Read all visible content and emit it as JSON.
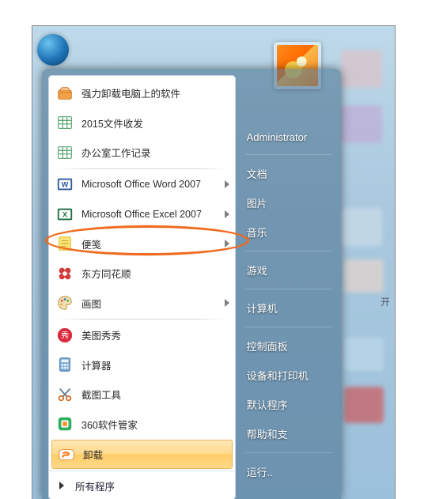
{
  "desktop": {
    "label_open": "开"
  },
  "user": {
    "name": "Administrator"
  },
  "programs": [
    {
      "icon": "box-orange",
      "label": "强力卸载电脑上的软件",
      "submenu": false
    },
    {
      "icon": "excel-grid",
      "label": "2015文件收发",
      "submenu": false
    },
    {
      "icon": "excel-grid",
      "label": "办公室工作记录",
      "submenu": false
    },
    {
      "icon": "word",
      "label": "Microsoft Office Word 2007",
      "submenu": true,
      "sep_before": true
    },
    {
      "icon": "excel",
      "label": "Microsoft Office Excel 2007",
      "submenu": true,
      "highlighted": true
    },
    {
      "icon": "note-yellow",
      "label": "便笺",
      "submenu": true
    },
    {
      "icon": "flower-red",
      "label": "东方同花顺",
      "submenu": false
    },
    {
      "icon": "paint",
      "label": "画图",
      "submenu": true
    },
    {
      "icon": "xiu",
      "label": "美图秀秀",
      "submenu": false,
      "sep_before": true
    },
    {
      "icon": "calc",
      "label": "计算器",
      "submenu": false
    },
    {
      "icon": "snip",
      "label": "截图工具",
      "submenu": false
    },
    {
      "icon": "guard-green",
      "label": "360软件管家",
      "submenu": false
    },
    {
      "icon": "sogou",
      "label": "卸载",
      "submenu": false,
      "selected": true
    }
  ],
  "all_programs_label": "所有程序",
  "right_panel": {
    "groups": [
      [
        "文档",
        "图片",
        "音乐"
      ],
      [
        "游戏"
      ],
      [
        "计算机"
      ],
      [
        "控制面板",
        "设备和打印机",
        "默认程序",
        "帮助和支"
      ],
      [
        "运行.."
      ]
    ]
  }
}
